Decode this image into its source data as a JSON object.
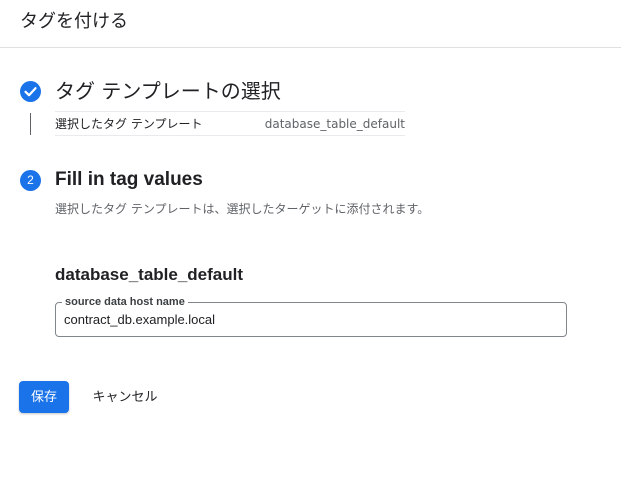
{
  "header": {
    "title": "タグを付ける"
  },
  "step1": {
    "icon": "check-circle-icon",
    "title": "タグ テンプレートの選択",
    "summary_label": "選択したタグ テンプレート",
    "summary_value": "database_table_default"
  },
  "step2": {
    "number": "2",
    "title": "Fill in tag values",
    "description": "選択したタグ テンプレートは、選択したターゲットに添付されます。",
    "template_name": "database_table_default",
    "field": {
      "label": "source data host name",
      "value": "contract_db.example.local"
    }
  },
  "actions": {
    "save_label": "保存",
    "cancel_label": "キャンセル"
  },
  "colors": {
    "accent": "#1a73e8",
    "text_primary": "#202124",
    "text_secondary": "#5f6368"
  }
}
